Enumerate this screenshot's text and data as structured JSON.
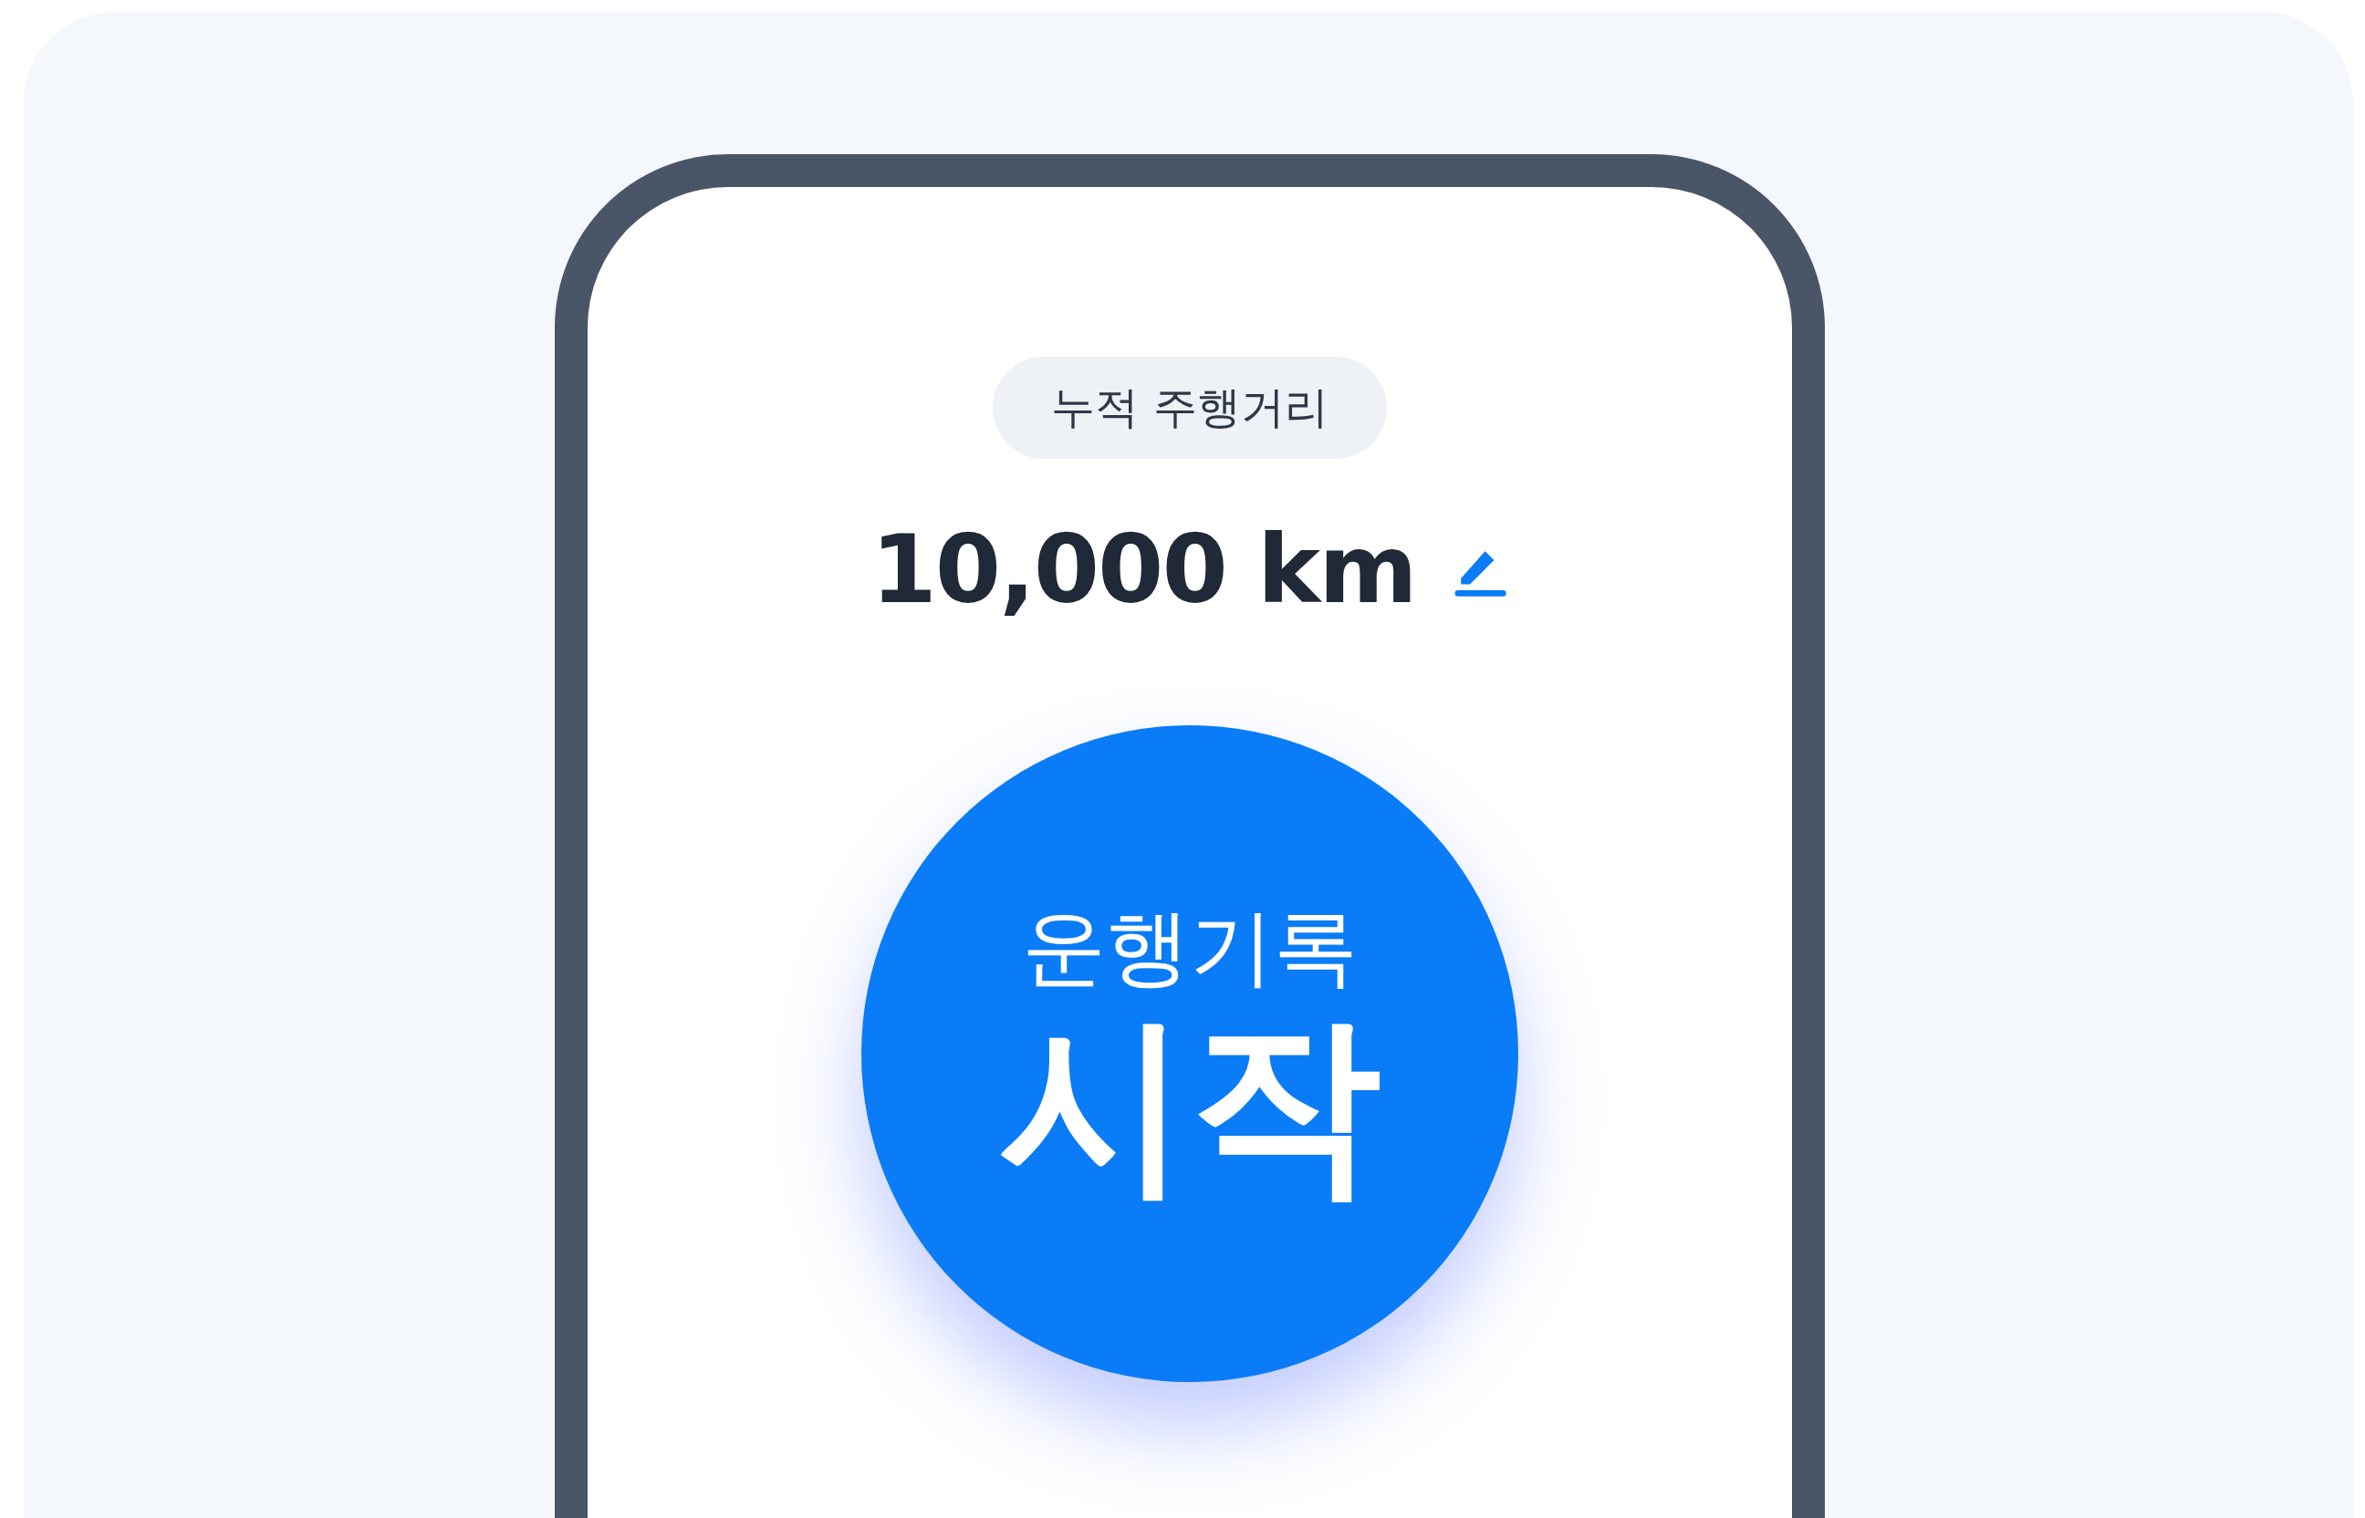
{
  "distance_label": "누적 주행거리",
  "distance_value": "10,000 km",
  "start_button": {
    "subtitle": "운행기록",
    "title": "시작"
  }
}
